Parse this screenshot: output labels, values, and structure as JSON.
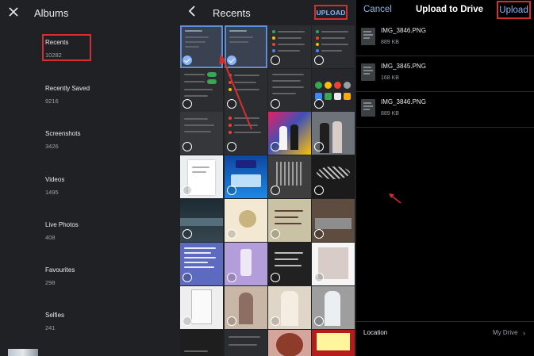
{
  "albums_panel": {
    "title": "Albums",
    "albums": [
      {
        "name": "Recents",
        "count": "10282"
      },
      {
        "name": "Recently Saved",
        "count": "9216"
      },
      {
        "name": "Screenshots",
        "count": "3426"
      },
      {
        "name": "Videos",
        "count": "1495"
      },
      {
        "name": "Live Photos",
        "count": "408"
      },
      {
        "name": "Favourites",
        "count": "298"
      },
      {
        "name": "Selfies",
        "count": "241"
      }
    ]
  },
  "recents_panel": {
    "title": "Recents",
    "upload_label": "UPLOAD",
    "selected_count": 2
  },
  "drive_panel": {
    "cancel_label": "Cancel",
    "title": "Upload to Drive",
    "upload_label": "Upload",
    "files": [
      {
        "name": "IMG_3846.PNG",
        "size": "889 KB"
      },
      {
        "name": "IMG_3845.PNG",
        "size": "168 KB"
      },
      {
        "name": "IMG_3846.PNG",
        "size": "889 KB"
      }
    ],
    "location_label": "Location",
    "location_value": "My Drive"
  },
  "colors": {
    "accent": "#8ab4f8",
    "highlight": "#d32f2f",
    "panel_bg": "#202124"
  },
  "icons": [
    "close-icon",
    "back-arrow-icon",
    "chevron-right-icon",
    "image-file-icon",
    "checkmark-icon"
  ]
}
